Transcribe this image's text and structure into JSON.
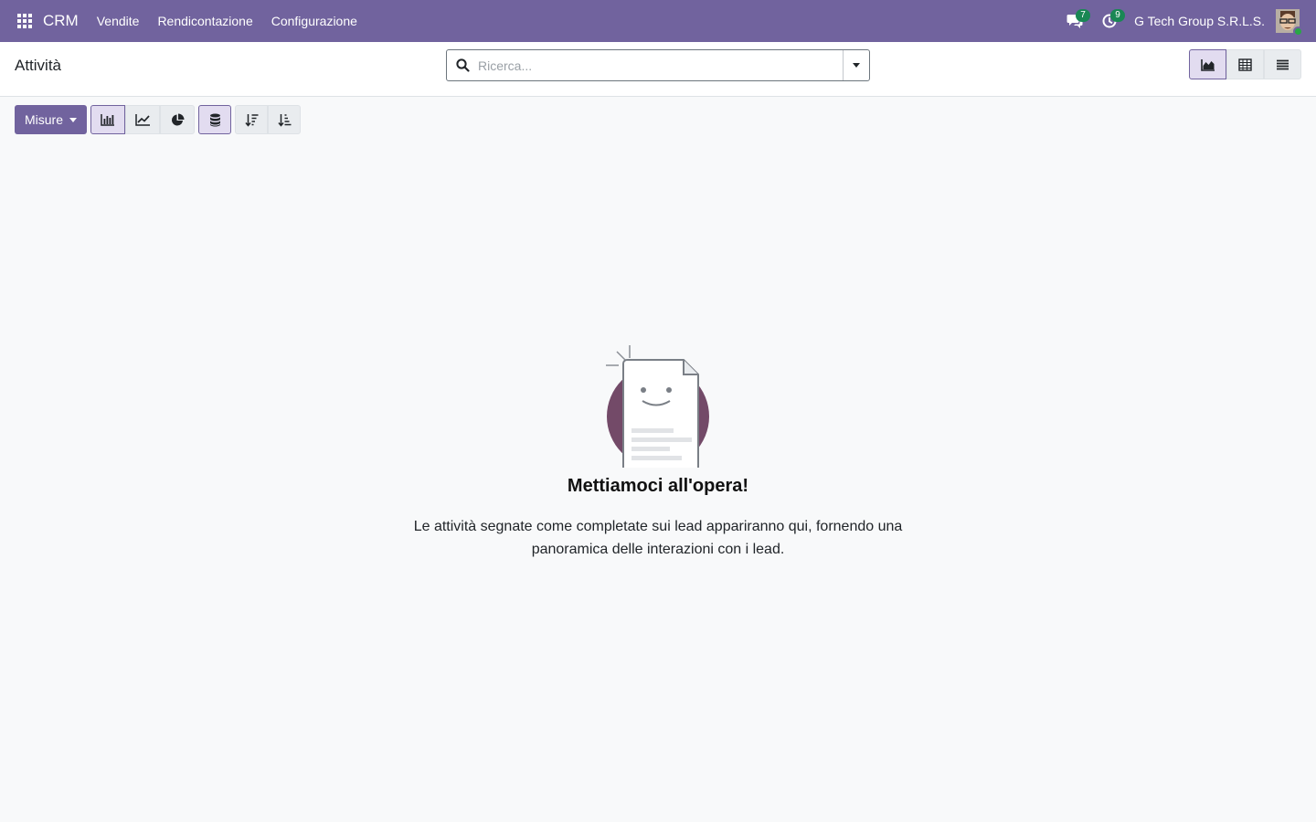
{
  "navbar": {
    "app_name": "CRM",
    "menu": [
      "Vendite",
      "Rendicontazione",
      "Configurazione"
    ],
    "messages_count": "7",
    "activities_count": "9",
    "company": "G Tech Group S.R.L.S.",
    "accent_color": "#71639e"
  },
  "control_panel": {
    "breadcrumb": "Attività",
    "search_placeholder": "Ricerca...",
    "views": [
      "graph-icon",
      "pivot-icon",
      "list-icon"
    ],
    "active_view": "graph"
  },
  "toolbar": {
    "measures_label": "Misure",
    "chart_types": [
      "bar-chart-icon",
      "line-chart-icon",
      "pie-chart-icon"
    ],
    "active_chart": "bar",
    "stacked_active": true,
    "sort_icons": [
      "sort-descending-icon",
      "sort-ascending-icon"
    ]
  },
  "empty_state": {
    "title": "Mettiamoci all'opera!",
    "text": "Le attività segnate come completate sui lead appariranno qui, fornendo una panoramica delle interazioni con i lead."
  }
}
